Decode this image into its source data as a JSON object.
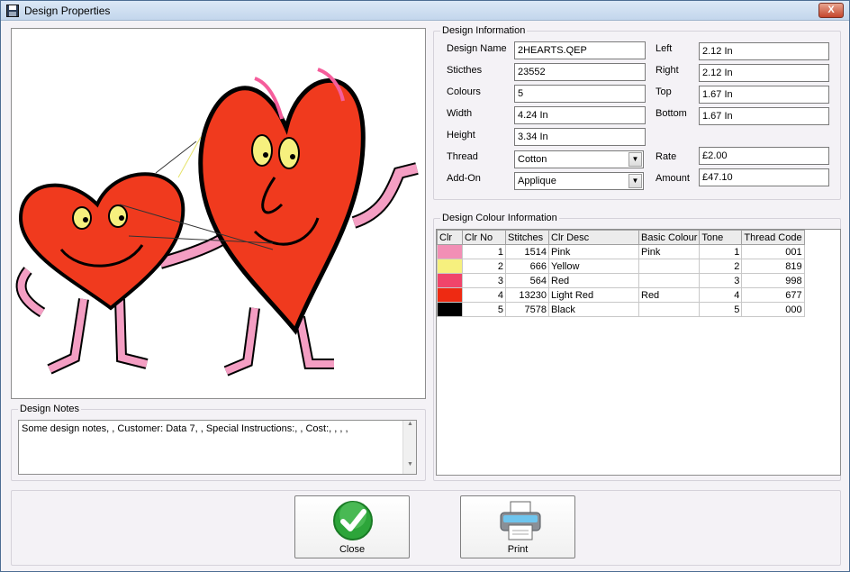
{
  "window": {
    "title": "Design Properties",
    "close_glyph": "X"
  },
  "info": {
    "group_title": "Design Information",
    "design_name_label": "Design Name",
    "design_name": "2HEARTS.QEP",
    "stitches_label": "Sticthes",
    "stitches": "23552",
    "colours_label": "Colours",
    "colours": "5",
    "width_label": "Width",
    "width": "4.24 In",
    "height_label": "Height",
    "height": "3.34 In",
    "thread_label": "Thread",
    "thread": "Cotton",
    "addon_label": "Add-On",
    "addon": "Applique",
    "left_label": "Left",
    "left": "2.12 In",
    "right_label": "Right",
    "right": "2.12 In",
    "top_label": "Top",
    "top": "1.67 In",
    "bottom_label": "Bottom",
    "bottom": "1.67 In",
    "rate_label": "Rate",
    "rate": "£2.00",
    "amount_label": "Amount",
    "amount": "£47.10"
  },
  "colours_group": {
    "title": "Design Colour Information",
    "columns": [
      "Clr",
      "Clr No",
      "Stitches",
      "Clr Desc",
      "Basic Colour",
      "Tone",
      "Thread Code"
    ],
    "rows": [
      {
        "color": "#f28fb5",
        "no": "1",
        "stitches": "1514",
        "desc": "Pink",
        "basic": "Pink",
        "tone": "1",
        "code": "001"
      },
      {
        "color": "#f6f07e",
        "no": "2",
        "stitches": "666",
        "desc": "Yellow",
        "basic": "",
        "tone": "2",
        "code": "819"
      },
      {
        "color": "#f0456b",
        "no": "3",
        "stitches": "564",
        "desc": "Red",
        "basic": "",
        "tone": "3",
        "code": "998"
      },
      {
        "color": "#ee2a12",
        "no": "4",
        "stitches": "13230",
        "desc": "Light Red",
        "basic": "Red",
        "tone": "4",
        "code": "677"
      },
      {
        "color": "#000000",
        "no": "5",
        "stitches": "7578",
        "desc": "Black",
        "basic": "",
        "tone": "5",
        "code": "000"
      }
    ]
  },
  "notes": {
    "title": "Design Notes",
    "text": "Some design notes, , Customer: Data 7, , Special Instructions:, , Cost:, , , ,"
  },
  "buttons": {
    "close": "Close",
    "print": "Print"
  }
}
